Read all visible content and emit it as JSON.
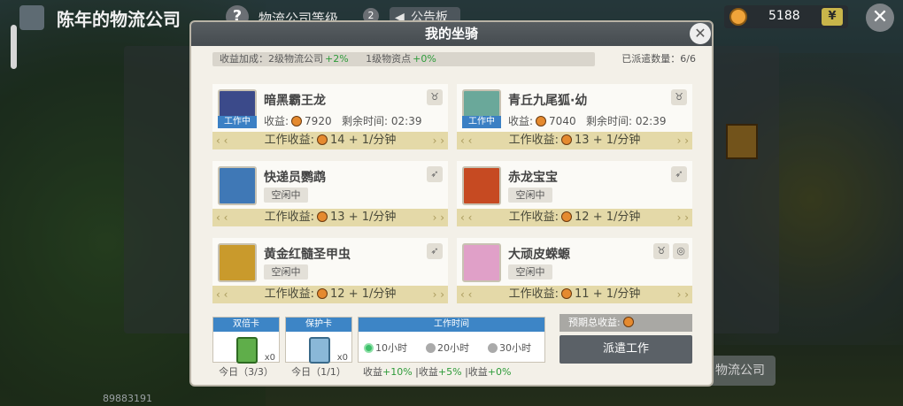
{
  "header": {
    "title": "陈年的物流公司",
    "level_label": "物流公司等级",
    "level_badge": "2",
    "notice_label": "公告板",
    "coins": "5188"
  },
  "bottom": {
    "player_id": "89883191",
    "logistics_button": "物流公司"
  },
  "modal": {
    "title": "我的坐骑",
    "bonus_text_1": "收益加成：2级物流公司",
    "bonus_value_1": "+2%",
    "bonus_text_2": "1级物资点",
    "bonus_value_2": "+0%",
    "dispatched_label": "已派遣数量：6/6",
    "mounts": [
      {
        "name": "暗黑霸王龙",
        "status": "工作中",
        "income_label": "收益:",
        "income": "7920",
        "time_label": "剩余时间:",
        "time": "02:39",
        "work_income": "工作收益:",
        "rate": "14 + 1/分钟",
        "type_icon": "bull-icon",
        "color": "#3b4a8a"
      },
      {
        "name": "青丘九尾狐·幼",
        "status": "工作中",
        "income_label": "收益:",
        "income": "7040",
        "time_label": "剩余时间:",
        "time": "02:39",
        "work_income": "工作收益:",
        "rate": "13 + 1/分钟",
        "type_icon": "bull-icon",
        "color": "#6aa89a"
      },
      {
        "name": "快递员鹦鹉",
        "status": "空闲中",
        "work_income": "工作收益:",
        "rate": "13 + 1/分钟",
        "type_icon": "wing-icon",
        "color": "#3f78b6"
      },
      {
        "name": "赤龙宝宝",
        "status": "空闲中",
        "work_income": "工作收益:",
        "rate": "12 + 1/分钟",
        "type_icon": "wing-icon",
        "color": "#c64a22"
      },
      {
        "name": "黄金红髓圣甲虫",
        "status": "空闲中",
        "work_income": "工作收益:",
        "rate": "12 + 1/分钟",
        "type_icon": "wing-icon",
        "color": "#c99a2c"
      },
      {
        "name": "大顽皮蝾螈",
        "status": "空闲中",
        "work_income": "工作收益:",
        "rate": "11 + 1/分钟",
        "type_icon": "bull-icon",
        "color": "#e0a0c8"
      }
    ],
    "double_card": {
      "label": "双倍卡",
      "count": "x0",
      "today": "今日（3/3）"
    },
    "protect_card": {
      "label": "保护卡",
      "count": "x0",
      "today": "今日（1/1）"
    },
    "work_time": {
      "label": "工作时间",
      "options": [
        "10小时",
        "20小时",
        "30小时"
      ],
      "selected": "10小时",
      "bonus_label": "收益",
      "bonuses": [
        "+10%",
        "+5%",
        "+0%"
      ]
    },
    "expected_label": "预期总收益:",
    "dispatch_button": "派遣工作"
  }
}
